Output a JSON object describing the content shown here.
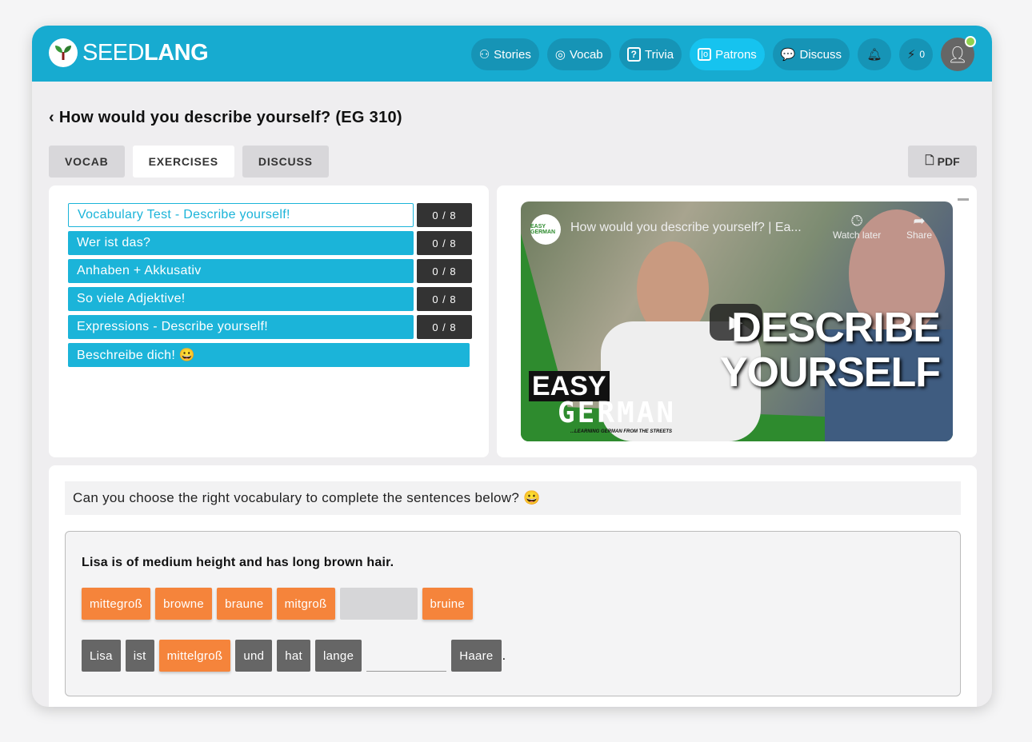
{
  "brand": {
    "name_light": "SEED",
    "name_bold": "LANG"
  },
  "nav": {
    "items": [
      {
        "label": "Stories"
      },
      {
        "label": "Vocab"
      },
      {
        "label": "Trivia"
      },
      {
        "label": "Patrons"
      },
      {
        "label": "Discuss"
      }
    ],
    "energy_count": "0"
  },
  "page": {
    "title": "How would you describe yourself? (EG 310)"
  },
  "tabs": [
    {
      "label": "VOCAB"
    },
    {
      "label": "EXERCISES"
    },
    {
      "label": "DISCUSS"
    }
  ],
  "pdf_label": "PDF",
  "exercises": [
    {
      "label": "Vocabulary Test - Describe yourself!",
      "score": "0 / 8"
    },
    {
      "label": "Wer ist das?",
      "score": "0 / 8"
    },
    {
      "label": "Anhaben + Akkusativ",
      "score": "0 / 8"
    },
    {
      "label": "So viele Adjektive!",
      "score": "0 / 8"
    },
    {
      "label": "Expressions - Describe yourself!",
      "score": "0 / 8"
    },
    {
      "label": "Beschreibe dich! 😀"
    }
  ],
  "video": {
    "title": "How would you describe yourself? | Ea...",
    "watch_later": "Watch later",
    "share": "Share",
    "thumb_line1": "DESCRIBE",
    "thumb_line2": "YOURSELF",
    "brand1": "EASY",
    "brand2": "GERMAN",
    "tagline": "...LEARNING GERMAN FROM THE STREETS",
    "channel": "EASY GERMAN"
  },
  "exercise": {
    "instruction": "Can you choose the right vocabulary to complete the sentences below? 😀",
    "prompt": "Lisa is of medium height and has long brown hair.",
    "options": [
      "mittegroß",
      "browne",
      "braune",
      "mitgroß",
      "",
      "bruine"
    ],
    "sentence": [
      "Lisa",
      "ist",
      "mittelgroß",
      "und",
      "hat",
      "lange",
      "",
      "Haare"
    ],
    "end": "."
  },
  "colors": {
    "header": "#17abd0",
    "accent": "#1bb4d9",
    "orange": "#f5843b"
  }
}
